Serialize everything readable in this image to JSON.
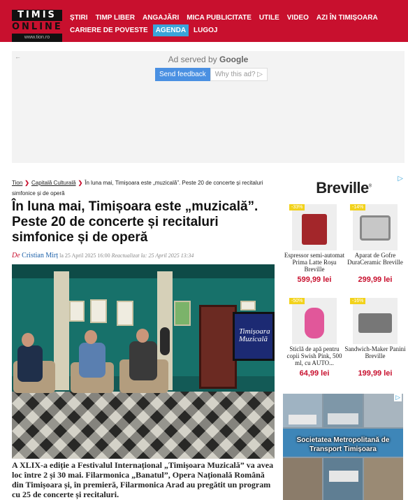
{
  "header": {
    "logo": {
      "line1": "TIMIS",
      "line2": "ONLINE",
      "url": "www.tion.ro"
    },
    "nav_row1": [
      "ȘTIRI",
      "TIMP LIBER",
      "ANGAJĂRI",
      "MICA PUBLICITATE",
      "UTILE",
      "VIDEO",
      "AZI ÎN TIMIȘOARA"
    ],
    "nav_row2": [
      "CARIERE DE POVESTE",
      "AGENDA",
      "LUGOJ"
    ],
    "active_nav": "AGENDA",
    "brand_color": "#c8102e",
    "active_color": "#3aa4d9"
  },
  "ad_top": {
    "back": "←",
    "served_prefix": "Ad served by ",
    "served_brand": "Google",
    "feedback_label": "Send feedback",
    "why_label": "Why this ad? ▷"
  },
  "article": {
    "breadcrumb": {
      "home": "Tion",
      "section": "Capitală Culturală",
      "current": "În luna mai, Timișoara este „muzicală”. Peste 20 de concerte și recitaluri simfonice și de operă",
      "sep": "❯"
    },
    "title": "În luna mai, Timișoara este „muzicală”. Peste 20 de concerte și recitaluri simfonice și de operă",
    "byline": {
      "prefix": "De ",
      "author": "Cristian Mirț",
      "published": " la 25 April 2025 16:00 ",
      "updated_label": "Reactualizat la:",
      "updated": " 25 April 2025 13:34"
    },
    "photo_screen_text": "Timișoara Muzicală",
    "lead": "A XLIX-a ediție a Festivalul Internațional „Timișoara Muzicală” va avea loc între 2 și 30 mai. Filarmonica „Banatul”, Opera Națională Română din Timișoara și, în premieră, Filarmonica Arad au pregătit un program cu 25 de concerte și recitaluri."
  },
  "sidebar_ad": {
    "ad_choice": "▷",
    "brand": "Breville",
    "brand_mark": "®",
    "products": [
      {
        "badge": "-33%",
        "name": "Espressor semi-automat Prima Latte Roșu Breville",
        "price": "599,99 lei"
      },
      {
        "badge": "-14%",
        "name": "Aparat de Gofre DuraCeramic Breville",
        "price": "299,99 lei"
      },
      {
        "badge": "-50%",
        "name": "Sticlă de apă pentru copii Swish Pink, 500 ml, cu AUTO...",
        "price": "64,99 lei"
      },
      {
        "badge": "-16%",
        "name": "Sandwich-Maker Panini Breville",
        "price": "199,99 lei"
      }
    ]
  },
  "sidebar_ad2": {
    "caption": "Societatea Metropolitană de Transport Timișoara",
    "ad_choice": "▷"
  }
}
